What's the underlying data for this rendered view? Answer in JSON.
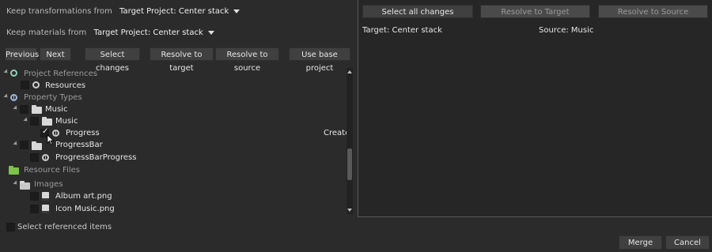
{
  "header": {
    "keep_transformations_label": "Keep transformations from",
    "keep_transformations_value": "Target Project: Center stack",
    "keep_materials_label": "Keep materials from",
    "keep_materials_value": "Target Project: Center stack"
  },
  "toolbar": {
    "previous": "Previous",
    "next": "Next",
    "select_changes": "Select changes",
    "resolve_to_target": "Resolve to target",
    "resolve_to_source": "Resolve to source",
    "use_base_project": "Use base project"
  },
  "tree": {
    "project_references": "Project References",
    "resources": "Resources",
    "property_types": "Property Types",
    "music_folder": "Music",
    "music_subfolder": "Music",
    "progress": "Progress",
    "progress_status": "Create",
    "progressbar_folder": "ProgressBar",
    "progressbar_progress": "ProgressBarProgress",
    "resource_files": "Resource Files",
    "images": "Images",
    "album_art": "Album art.png",
    "icon_music": "Icon Music.png"
  },
  "footer": {
    "select_referenced": "Select referenced items",
    "merge": "Merge",
    "cancel": "Cancel"
  },
  "right_panel": {
    "select_all_changes": "Select all changes",
    "resolve_to_target": "Resolve to Target",
    "resolve_to_source": "Resolve to Source",
    "target_label": "Target:",
    "target_value": "Center stack",
    "source_label": "Source:",
    "source_value": "Music"
  }
}
